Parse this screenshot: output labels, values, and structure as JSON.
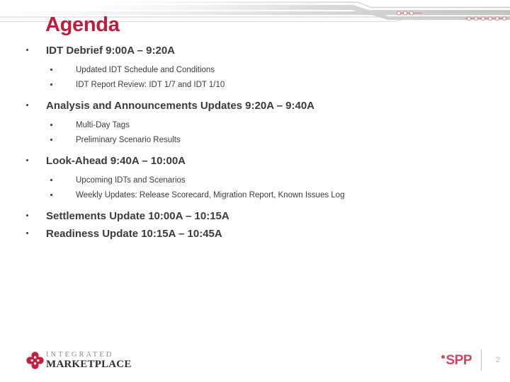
{
  "slide": {
    "title": "Agenda",
    "title_color": "#be1e3c",
    "body_text_color": "#3b3b3b"
  },
  "agenda": [
    {
      "heading": "IDT Debrief 9:00A – 9:20A",
      "items": [
        "Updated IDT Schedule and Conditions",
        "IDT Report Review: IDT 1/7 and IDT 1/10"
      ]
    },
    {
      "heading": "Analysis and Announcements Updates 9:20A – 9:40A",
      "items": [
        "Multi-Day Tags",
        "Preliminary Scenario Results"
      ]
    },
    {
      "heading": "Look-Ahead 9:40A – 10:00A",
      "items": [
        "Upcoming IDTs and Scenarios",
        "Weekly Updates: Release Scorecard, Migration Report, Known Issues Log"
      ]
    },
    {
      "heading": "Settlements Update 10:00A – 10:15A",
      "items": []
    },
    {
      "heading": "Readiness Update 10:15A – 10:45A",
      "items": []
    }
  ],
  "footer": {
    "integrated_marketplace": {
      "line1": "INTEGRATED",
      "line2": "MARKETPLACE",
      "mark_color": "#c0203f"
    },
    "spp": {
      "label": "SPP",
      "color": "#d2455c"
    },
    "page_number": "2"
  },
  "decoration": {
    "band_color": "#c9c9c9",
    "line_color": "#cfcfcf",
    "circle_color": "#d4737f",
    "left_circle_count": 3,
    "right_circle_count": 6
  }
}
